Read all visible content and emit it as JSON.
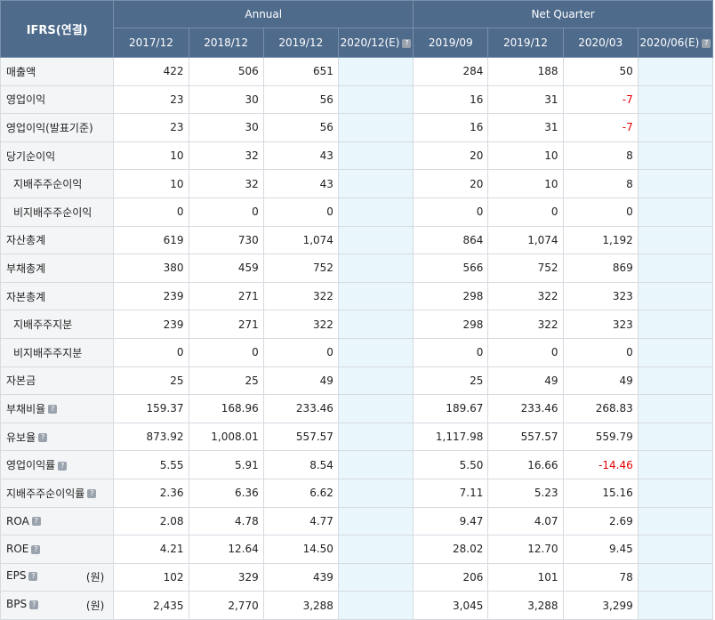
{
  "header": {
    "corner": "IFRS(연결)",
    "group_annual": "Annual",
    "group_quarter": "Net Quarter",
    "periods": [
      "2017/12",
      "2018/12",
      "2019/12",
      "2020/12(E)",
      "2019/09",
      "2019/12",
      "2020/03",
      "2020/06(E)"
    ]
  },
  "rows": [
    {
      "label": "매출액",
      "values": [
        "422",
        "506",
        "651",
        "",
        "284",
        "188",
        "50",
        ""
      ]
    },
    {
      "label": "영업이익",
      "values": [
        "23",
        "30",
        "56",
        "",
        "16",
        "31",
        "-7",
        ""
      ]
    },
    {
      "label": "영업이익(발표기준)",
      "values": [
        "23",
        "30",
        "56",
        "",
        "16",
        "31",
        "-7",
        ""
      ]
    },
    {
      "label": "당기순이익",
      "values": [
        "10",
        "32",
        "43",
        "",
        "20",
        "10",
        "8",
        ""
      ]
    },
    {
      "label": "지배주주순이익",
      "values": [
        "10",
        "32",
        "43",
        "",
        "20",
        "10",
        "8",
        ""
      ]
    },
    {
      "label": "비지배주주순이익",
      "values": [
        "0",
        "0",
        "0",
        "",
        "0",
        "0",
        "0",
        ""
      ]
    },
    {
      "label": "자산총계",
      "values": [
        "619",
        "730",
        "1,074",
        "",
        "864",
        "1,074",
        "1,192",
        ""
      ]
    },
    {
      "label": "부채총계",
      "values": [
        "380",
        "459",
        "752",
        "",
        "566",
        "752",
        "869",
        ""
      ]
    },
    {
      "label": "자본총계",
      "values": [
        "239",
        "271",
        "322",
        "",
        "298",
        "322",
        "323",
        ""
      ]
    },
    {
      "label": "지배주주지분",
      "values": [
        "239",
        "271",
        "322",
        "",
        "298",
        "322",
        "323",
        ""
      ]
    },
    {
      "label": "비지배주주지분",
      "values": [
        "0",
        "0",
        "0",
        "",
        "0",
        "0",
        "0",
        ""
      ]
    },
    {
      "label": "자본금",
      "values": [
        "25",
        "25",
        "49",
        "",
        "25",
        "49",
        "49",
        ""
      ]
    },
    {
      "label": "부채비율",
      "values": [
        "159.37",
        "168.96",
        "233.46",
        "",
        "189.67",
        "233.46",
        "268.83",
        ""
      ]
    },
    {
      "label": "유보율",
      "values": [
        "873.92",
        "1,008.01",
        "557.57",
        "",
        "1,117.98",
        "557.57",
        "559.79",
        ""
      ]
    },
    {
      "label": "영업이익률",
      "values": [
        "5.55",
        "5.91",
        "8.54",
        "",
        "5.50",
        "16.66",
        "-14.46",
        ""
      ]
    },
    {
      "label": "지배주주순이익률",
      "values": [
        "2.36",
        "6.36",
        "6.62",
        "",
        "7.11",
        "5.23",
        "15.16",
        ""
      ]
    },
    {
      "label": "ROA",
      "values": [
        "2.08",
        "4.78",
        "4.77",
        "",
        "9.47",
        "4.07",
        "2.69",
        ""
      ]
    },
    {
      "label": "ROE",
      "values": [
        "4.21",
        "12.64",
        "14.50",
        "",
        "28.02",
        "12.70",
        "9.45",
        ""
      ]
    },
    {
      "label": "EPS",
      "unit": "(원)",
      "values": [
        "102",
        "329",
        "439",
        "",
        "206",
        "101",
        "78",
        ""
      ]
    },
    {
      "label": "BPS",
      "unit": "(원)",
      "values": [
        "2,435",
        "2,770",
        "3,288",
        "",
        "3,045",
        "3,288",
        "3,299",
        ""
      ]
    }
  ],
  "help_icon_glyph": "?",
  "colors": {
    "header_bg": "#4e6b8c",
    "estimate_bg": "#e9f6fb",
    "negative": "#e00000",
    "label_bg": "#f4f5f7"
  }
}
